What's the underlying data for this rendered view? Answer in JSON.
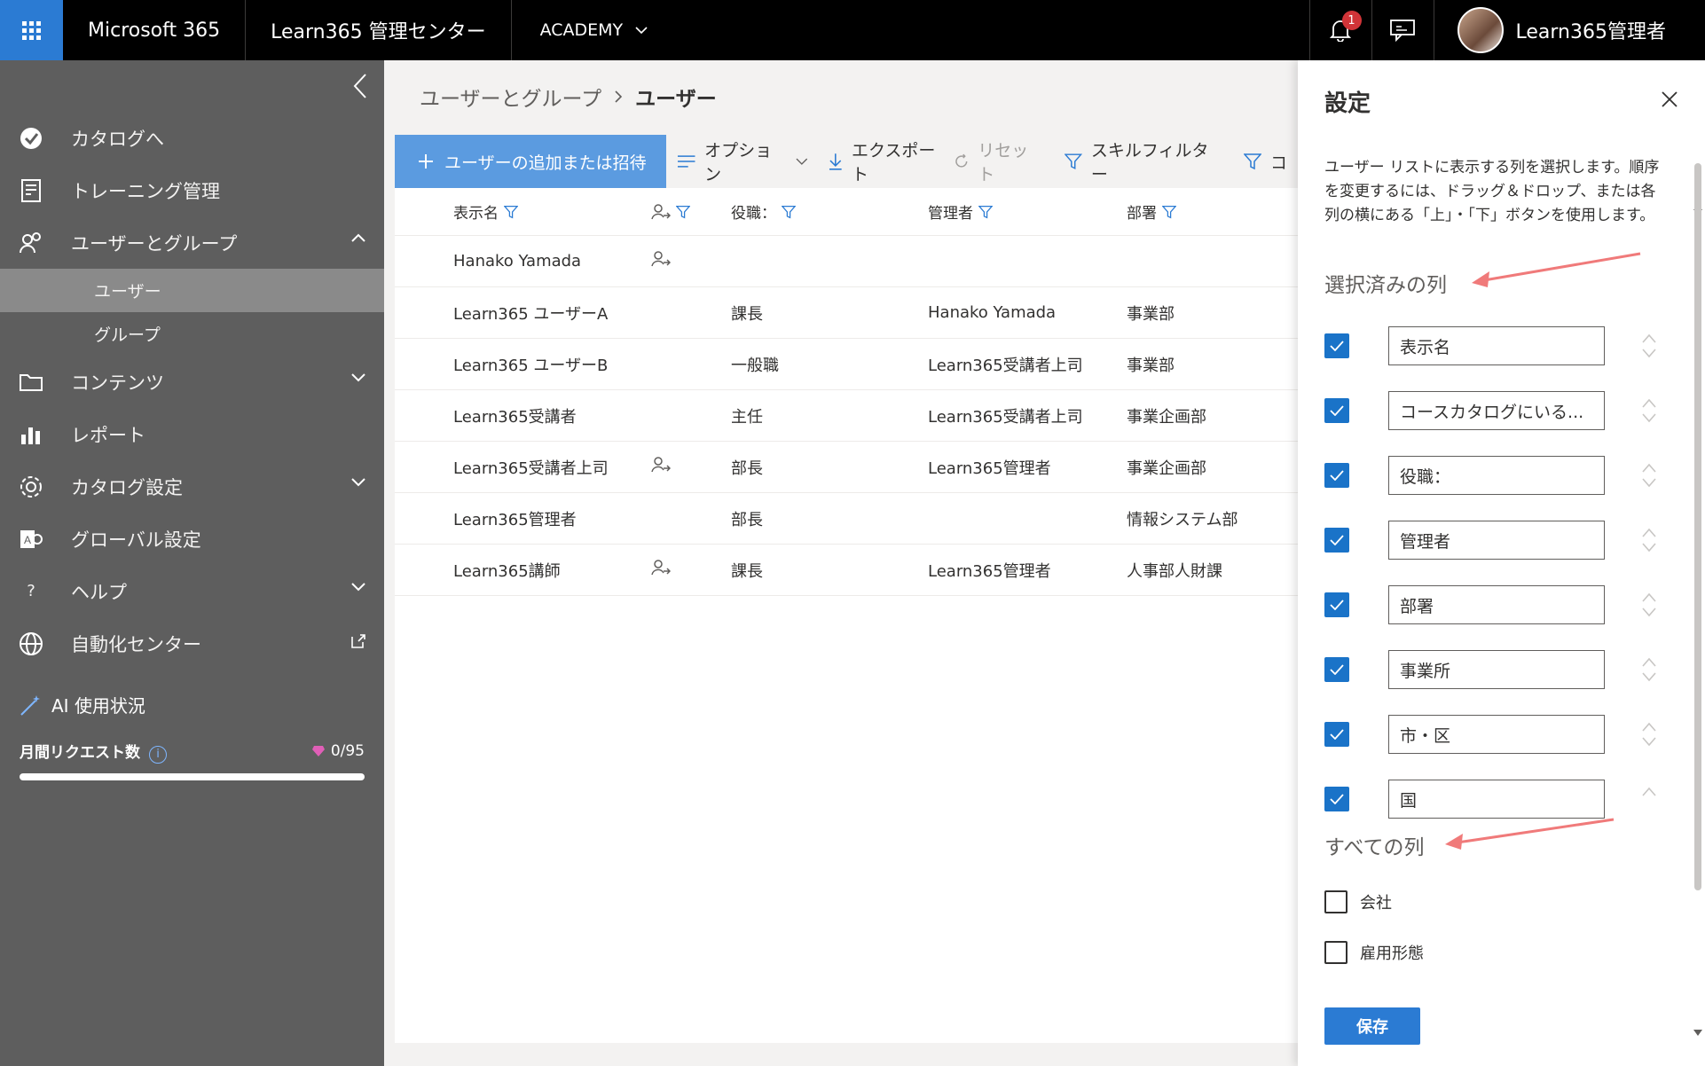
{
  "topbar": {
    "brand": "Microsoft 365",
    "center_title": "Learn365 管理センター",
    "org": "ACADEMY",
    "notification_count": "1",
    "user_name": "Learn365管理者"
  },
  "sidebar": {
    "items": [
      {
        "label": "カタログへ"
      },
      {
        "label": "トレーニング管理"
      },
      {
        "label": "ユーザーとグループ"
      },
      {
        "label": "ユーザー"
      },
      {
        "label": "グループ"
      },
      {
        "label": "コンテンツ"
      },
      {
        "label": "レポート"
      },
      {
        "label": "カタログ設定"
      },
      {
        "label": "グローバル設定"
      },
      {
        "label": "ヘルプ"
      },
      {
        "label": "自動化センター"
      }
    ],
    "ai_title": "AI 使用状況",
    "monthly_requests_label": "月間リクエスト数",
    "monthly_requests_count": "0/95",
    "monthly_requests_used_fraction": 0.0
  },
  "main": {
    "breadcrumb_parent": "ユーザーとグループ",
    "breadcrumb_current": "ユーザー",
    "toolbar": {
      "add": "ユーザーの追加または招待",
      "options": "オプション",
      "export": "エクスポート",
      "reset": "リセット",
      "skill_filter": "スキルフィルター",
      "more": "コ"
    },
    "columns": [
      "表示名",
      "役職：",
      "管理者",
      "部署"
    ],
    "rows": [
      {
        "name": "Hanako Yamada",
        "role": "",
        "manager": "",
        "dept": ""
      },
      {
        "name": "Learn365 ユーザーA",
        "role": "課長",
        "manager": "Hanako Yamada",
        "dept": "事業部"
      },
      {
        "name": "Learn365 ユーザーB",
        "role": "一般職",
        "manager": "Learn365受講者上司",
        "dept": "事業部"
      },
      {
        "name": "Learn365受講者",
        "role": "主任",
        "manager": "Learn365受講者上司",
        "dept": "事業企画部"
      },
      {
        "name": "Learn365受講者上司",
        "role": "部長",
        "manager": "Learn365管理者",
        "dept": "事業企画部"
      },
      {
        "name": "Learn365管理者",
        "role": "部長",
        "manager": "",
        "dept": "情報システム部"
      },
      {
        "name": "Learn365講師",
        "role": "課長",
        "manager": "Learn365管理者",
        "dept": "人事部人財課"
      }
    ]
  },
  "panel": {
    "title": "設定",
    "description": "ユーザー リストに表示する列を選択します。順序を変更するには、ドラッグ＆ドロップ、または各列の横にある「上」・「下」ボタンを使用します。",
    "selected_heading": "選択済みの列",
    "selected_columns": [
      "表示名",
      "コースカタログにいる...",
      "役職：",
      "管理者",
      "部署",
      "事業所",
      "市・区",
      "国"
    ],
    "all_heading": "すべての列",
    "all_columns": [
      "会社",
      "雇用形態"
    ],
    "save": "保存"
  },
  "colors": {
    "accent": "#2b7bd3",
    "sidebar": "#5e5e5e",
    "annotation_arrow": "#f07a7a"
  }
}
